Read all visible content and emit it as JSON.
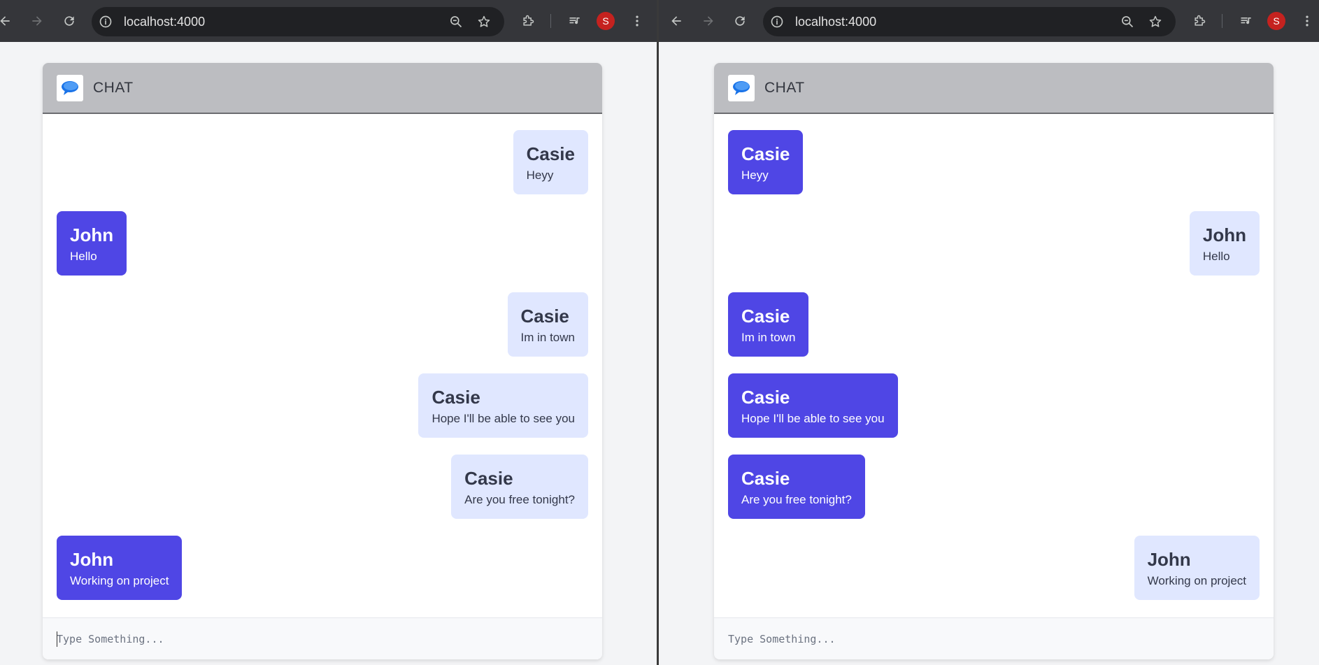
{
  "browser": {
    "url": "localhost:4000",
    "avatar_letter": "S",
    "avatar_color": "#c5221f",
    "toolbar_color": "#35363a",
    "omnibox_color": "#202124",
    "icons": [
      "back-arrow-icon",
      "forward-arrow-icon",
      "reload-icon",
      "info-icon",
      "zoom-out-icon",
      "star-icon",
      "extensions-icon",
      "media-controls-icon",
      "more-vert-icon"
    ]
  },
  "chat": {
    "title": "CHAT",
    "input_placeholder": "Type Something...",
    "colors": {
      "header_bg": "#bcbdc1",
      "dark_bubble": "#4f46e5",
      "light_bubble": "#e0e7ff"
    }
  },
  "left_pane": {
    "viewer": "Casie",
    "messages": [
      {
        "sender": "Casie",
        "text": "Heyy",
        "side": "right",
        "style": "light"
      },
      {
        "sender": "John",
        "text": "Hello",
        "side": "left",
        "style": "dark"
      },
      {
        "sender": "Casie",
        "text": "Im in town",
        "side": "right",
        "style": "light"
      },
      {
        "sender": "Casie",
        "text": "Hope I'll be able to see you",
        "side": "right",
        "style": "light"
      },
      {
        "sender": "Casie",
        "text": "Are you free tonight?",
        "side": "right",
        "style": "light"
      },
      {
        "sender": "John",
        "text": "Working on project",
        "side": "left",
        "style": "dark"
      }
    ]
  },
  "right_pane": {
    "viewer": "John",
    "messages": [
      {
        "sender": "Casie",
        "text": "Heyy",
        "side": "left",
        "style": "dark"
      },
      {
        "sender": "John",
        "text": "Hello",
        "side": "right",
        "style": "light"
      },
      {
        "sender": "Casie",
        "text": "Im in town",
        "side": "left",
        "style": "dark"
      },
      {
        "sender": "Casie",
        "text": "Hope I'll be able to see you",
        "side": "left",
        "style": "dark"
      },
      {
        "sender": "Casie",
        "text": "Are you free tonight?",
        "side": "left",
        "style": "dark"
      },
      {
        "sender": "John",
        "text": "Working on project",
        "side": "right",
        "style": "light"
      }
    ]
  }
}
